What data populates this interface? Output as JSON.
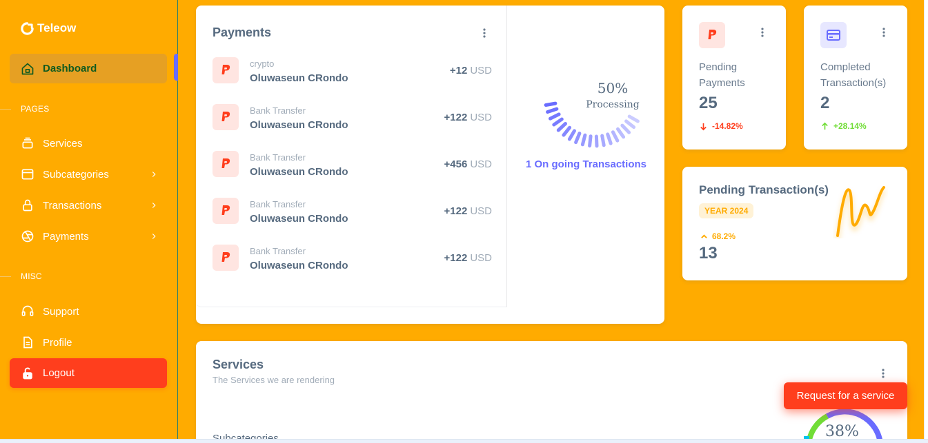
{
  "brand": {
    "name": "Teleow"
  },
  "sidebar": {
    "active": {
      "label": "Dashboard",
      "icon": "home-icon"
    },
    "section_pages": "PAGES",
    "pages": [
      {
        "label": "Services",
        "icon": "layers-icon",
        "has_submenu": false
      },
      {
        "label": "Subcategories",
        "icon": "window-icon",
        "has_submenu": true
      },
      {
        "label": "Transactions",
        "icon": "lock-icon",
        "has_submenu": true
      },
      {
        "label": "Payments",
        "icon": "aperture-icon",
        "has_submenu": true
      }
    ],
    "section_misc": "MISC",
    "misc": [
      {
        "label": "Support",
        "icon": "headset-icon"
      },
      {
        "label": "Profile",
        "icon": "file-icon"
      }
    ],
    "logout": {
      "label": "Logout",
      "icon": "unlock-icon"
    }
  },
  "payments": {
    "title": "Payments",
    "rows": [
      {
        "type": "crypto",
        "name": "Oluwaseun CRondo",
        "amount": "+12",
        "currency": "USD"
      },
      {
        "type": "Bank Transfer",
        "name": "Oluwaseun CRondo",
        "amount": "+122",
        "currency": "USD"
      },
      {
        "type": "Bank Transfer",
        "name": "Oluwaseun CRondo",
        "amount": "+456",
        "currency": "USD"
      },
      {
        "type": "Bank Transfer",
        "name": "Oluwaseun CRondo",
        "amount": "+122",
        "currency": "USD"
      },
      {
        "type": "Bank Transfer",
        "name": "Oluwaseun CRondo",
        "amount": "+122",
        "currency": "USD"
      }
    ],
    "progress": {
      "percent": "50%",
      "label": "Processing",
      "value": 0.5
    },
    "ongoing": "1 On going Transactions"
  },
  "stats": [
    {
      "label": "Pending Payments",
      "value": "25",
      "delta": "-14.82%",
      "direction": "down",
      "icon": "paypal-icon",
      "color": "#ff3e1d"
    },
    {
      "label": "Completed Transaction(s)",
      "value": "2",
      "delta": "+28.14%",
      "direction": "up",
      "icon": "credit-card-icon",
      "color": "#71dd37"
    }
  ],
  "pending_transactions": {
    "title": "Pending Transaction(s)",
    "badge": "YEAR 2024",
    "delta": "68.2%",
    "value": "13"
  },
  "services": {
    "title": "Services",
    "subtitle": "The Services we are rendering",
    "category_label": "Subcategories",
    "request_button": "Request for a service",
    "donut_percent": "38%"
  },
  "colors": {
    "primary": "#696cff",
    "warning": "#ffab00",
    "danger": "#ff3e1d",
    "success": "#71dd37"
  }
}
